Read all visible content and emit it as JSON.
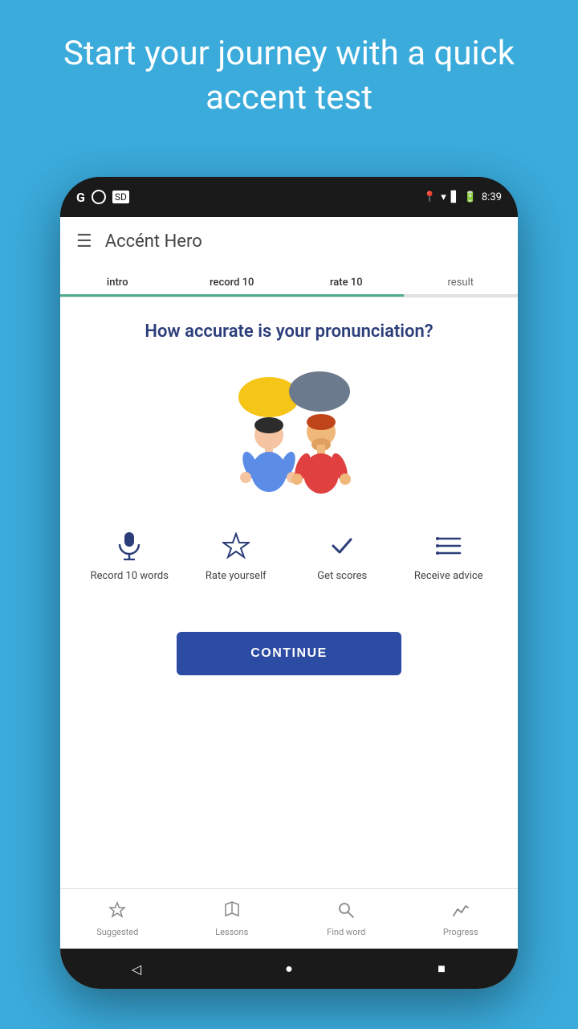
{
  "background": {
    "header_text": "Start your journey with a quick accent test",
    "color": "#3aabdb"
  },
  "status_bar": {
    "time": "8:39",
    "icons": [
      "location",
      "wifi",
      "signal",
      "battery"
    ]
  },
  "top_bar": {
    "title": "Accént Hero",
    "menu_icon": "☰"
  },
  "tabs": [
    {
      "label": "intro",
      "state": "active"
    },
    {
      "label": "record 10",
      "state": "active"
    },
    {
      "label": "rate 10",
      "state": "active"
    },
    {
      "label": "result",
      "state": "inactive"
    }
  ],
  "main": {
    "question": "How accurate is your pronunciation?",
    "steps": [
      {
        "icon": "🎤",
        "label": "Record 10 words"
      },
      {
        "icon": "⭐",
        "label": "Rate yourself"
      },
      {
        "icon": "✓",
        "label": "Get scores"
      },
      {
        "icon": "≡",
        "label": "Receive advice"
      }
    ],
    "continue_button": "CONTINUE"
  },
  "bottom_nav": [
    {
      "icon": "☆",
      "label": "Suggested"
    },
    {
      "icon": "📖",
      "label": "Lessons"
    },
    {
      "icon": "🔍",
      "label": "Find word"
    },
    {
      "icon": "📈",
      "label": "Progress"
    }
  ],
  "android_nav": {
    "back": "◁",
    "home": "●",
    "recent": "■"
  }
}
